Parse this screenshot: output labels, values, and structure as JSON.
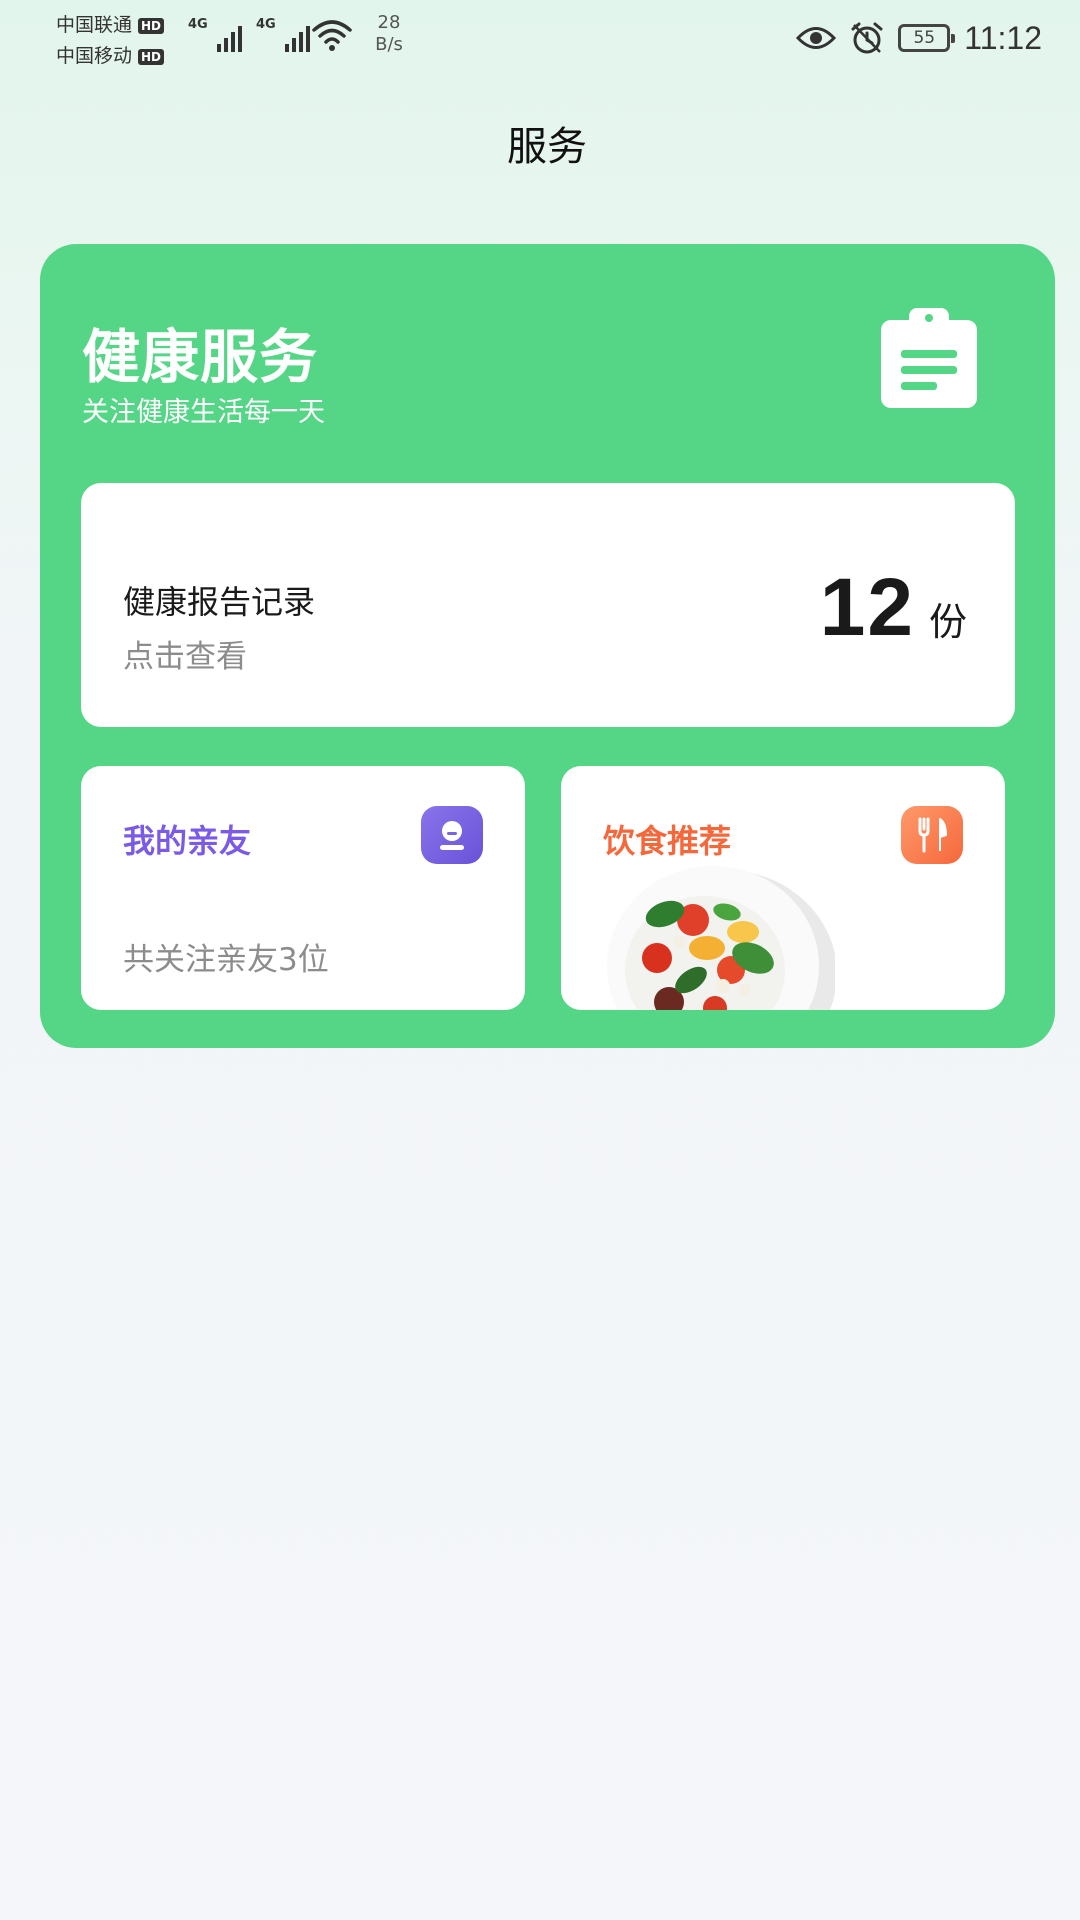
{
  "status_bar": {
    "carrier_1": "中国联通",
    "carrier_2": "中国移动",
    "hd_badge": "HD",
    "network_type": "4G",
    "speed_value": "28",
    "speed_unit": "B/s",
    "battery_level": "55",
    "time": "11:12"
  },
  "page": {
    "title": "服务"
  },
  "health_card": {
    "title": "健康服务",
    "subtitle": "关注健康生活每一天",
    "background_color": "#55d686",
    "icon": "clipboard-icon",
    "report": {
      "title": "健康报告记录",
      "hint": "点击查看",
      "count": "12",
      "unit": "份"
    },
    "friends": {
      "title": "我的亲友",
      "description": "共关注亲友3位",
      "icon": "friend-avatar-icon",
      "accent_color": "#7b5be6"
    },
    "diet": {
      "title": "饮食推荐",
      "icon": "fork-spoon-icon",
      "image": "salad-bowl",
      "accent_color": "#f5683c"
    }
  }
}
